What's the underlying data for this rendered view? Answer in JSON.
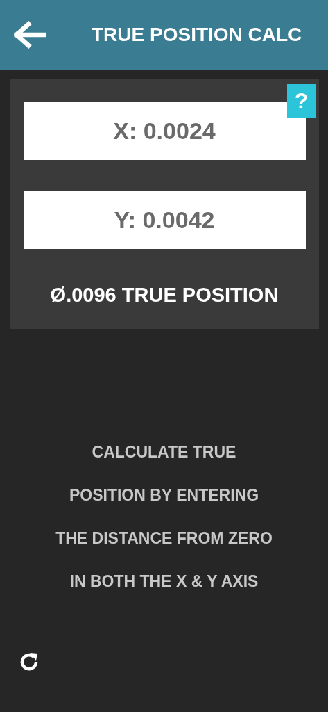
{
  "header": {
    "title": "TRUE POSITION CALC"
  },
  "calculator": {
    "help": "?",
    "fields": [
      {
        "value": "X: 0.0024"
      },
      {
        "value": "Y: 0.0042"
      }
    ],
    "result": "Ø.0096 TRUE POSITION"
  },
  "description": "CALCULATE TRUE POSITION BY ENTERING THE DISTANCE FROM ZERO IN BOTH THE X & Y AXIS"
}
